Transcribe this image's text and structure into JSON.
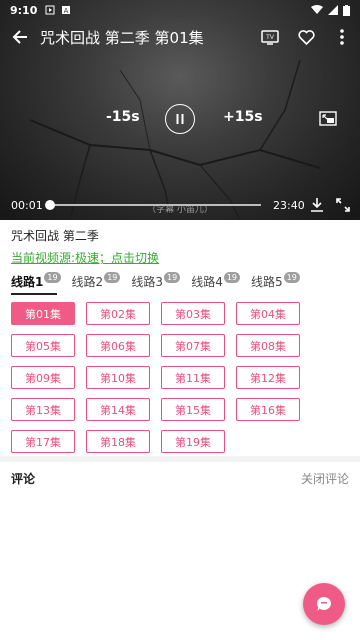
{
  "status": {
    "time": "9:10"
  },
  "player": {
    "title": "咒术回战 第二季 第01集",
    "skip_back": "-15s",
    "skip_forward": "+15s",
    "current_time": "00:01",
    "duration": "23:40",
    "progress": 0.001,
    "subtitle": "（字幕 小笛儿）"
  },
  "info": {
    "show_title": "咒术回战 第二季",
    "source_text": "当前视频源:极速；点击切换"
  },
  "lines": [
    {
      "label": "线路1",
      "count": "19",
      "active": true
    },
    {
      "label": "线路2",
      "count": "19",
      "active": false
    },
    {
      "label": "线路3",
      "count": "19",
      "active": false
    },
    {
      "label": "线路4",
      "count": "19",
      "active": false
    },
    {
      "label": "线路5",
      "count": "19",
      "active": false
    }
  ],
  "episodes": [
    "第01集",
    "第02集",
    "第03集",
    "第04集",
    "第05集",
    "第06集",
    "第07集",
    "第08集",
    "第09集",
    "第10集",
    "第11集",
    "第12集",
    "第13集",
    "第14集",
    "第15集",
    "第16集",
    "第17集",
    "第18集",
    "第19集"
  ],
  "active_episode": 0,
  "comments": {
    "title": "评论",
    "toggle": "关闭评论"
  },
  "colors": {
    "accent": "#ef5a86",
    "link": "#3aaa35"
  }
}
